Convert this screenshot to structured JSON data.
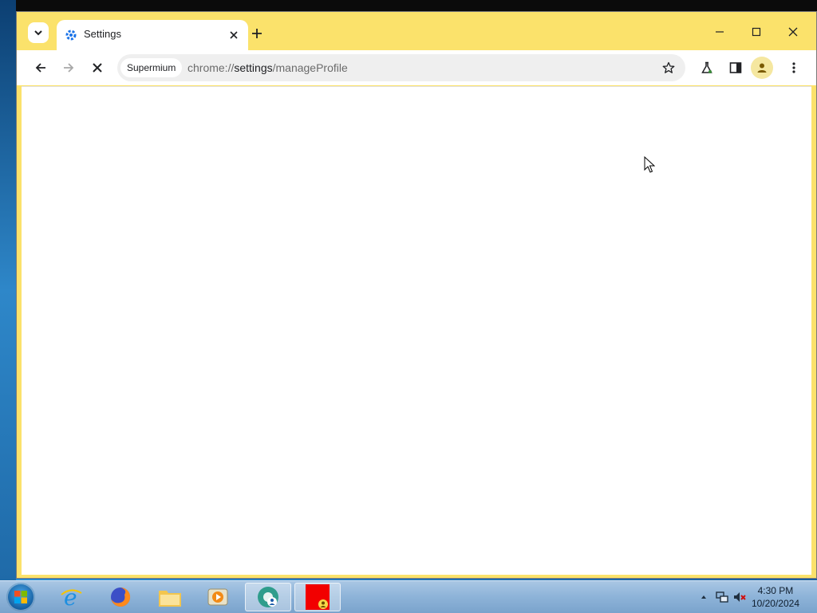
{
  "browser": {
    "tab": {
      "title": "Settings"
    },
    "omnibox": {
      "chip": "Supermium",
      "url_scheme": "chrome://",
      "url_host": "settings",
      "url_path": "/manageProfile"
    }
  },
  "colors": {
    "frame": "#fbe26b",
    "toolbar": "#ffffff",
    "omnibox": "#efefef",
    "taskbar": "#8db3d8"
  },
  "icons": {
    "tab_search": "chevron-down-icon",
    "tab_favicon": "settings-gear-icon",
    "tab_close": "close-icon",
    "new_tab": "plus-icon",
    "minimize": "minimize-icon",
    "maximize": "maximize-icon",
    "close": "close-icon",
    "back": "back-arrow-icon",
    "forward": "forward-arrow-icon",
    "stop": "stop-icon",
    "bookmark": "star-icon",
    "labs": "flask-icon",
    "side_panel": "side-panel-icon",
    "profile": "avatar-icon",
    "menu": "kebab-menu-icon"
  },
  "taskbar": {
    "clock_time": "4:30 PM",
    "clock_date": "10/20/2024",
    "apps": [
      "internet-explorer",
      "firefox",
      "file-explorer",
      "media-player",
      "supermium",
      "red-app"
    ]
  }
}
